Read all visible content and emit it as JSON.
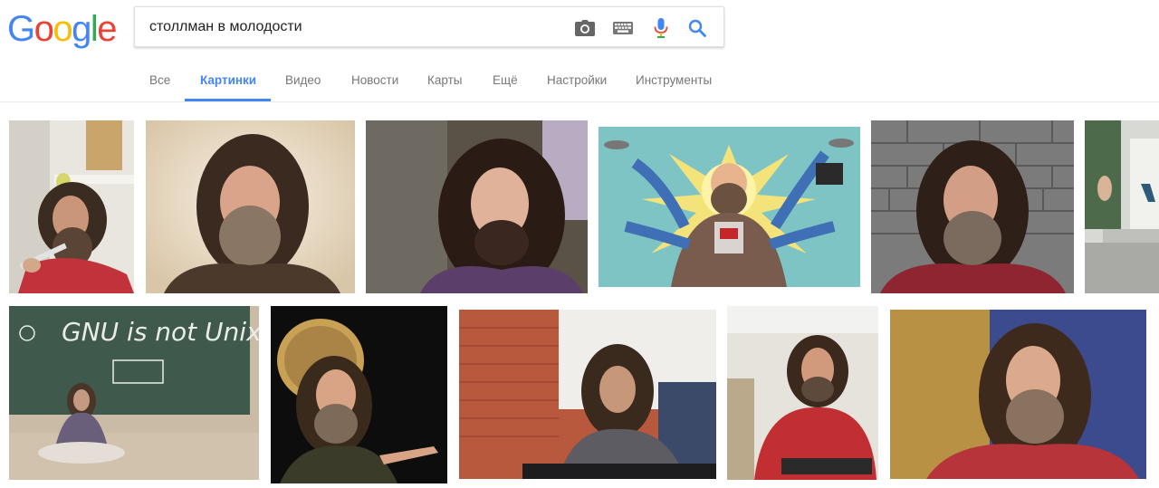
{
  "logo": {
    "letters": [
      "G",
      "o",
      "o",
      "g",
      "l",
      "e"
    ],
    "colors": [
      "#4285f4",
      "#ea4335",
      "#fbbc05",
      "#4285f4",
      "#34a853",
      "#ea4335"
    ]
  },
  "search": {
    "query": "столлман в молодости",
    "icons": [
      "camera-icon",
      "keyboard-icon",
      "microphone-icon",
      "search-icon"
    ]
  },
  "tabs": [
    {
      "label": "Все",
      "active": false
    },
    {
      "label": "Картинки",
      "active": true
    },
    {
      "label": "Видео",
      "active": false
    },
    {
      "label": "Новости",
      "active": false
    },
    {
      "label": "Карты",
      "active": false
    },
    {
      "label": "Ещё",
      "active": false
    },
    {
      "label": "Настройки",
      "active": false
    },
    {
      "label": "Инструменты",
      "active": false
    }
  ],
  "colors": {
    "accent": "#4285f4",
    "tab_text": "#777777"
  },
  "results": {
    "thumb_4": {
      "board_text_line1": "GNU is not Unix"
    }
  }
}
